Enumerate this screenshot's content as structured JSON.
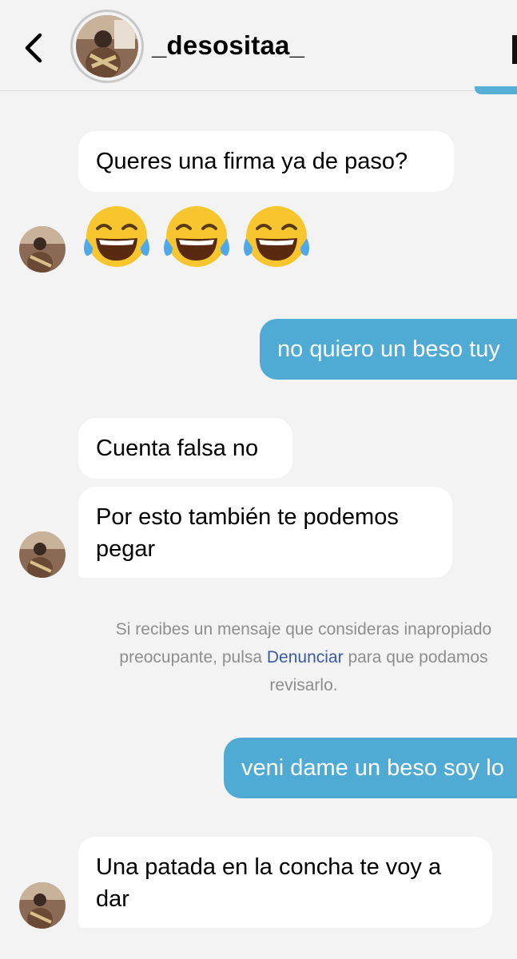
{
  "header": {
    "username": "_desositaa_",
    "back_icon": "chevron-left-icon"
  },
  "messages": [
    {
      "direction": "in",
      "text": "Queres una firma ya de paso?"
    },
    {
      "direction": "in",
      "type": "emoji",
      "emojis": [
        "face-with-tears-of-joy",
        "face-with-tears-of-joy",
        "face-with-tears-of-joy"
      ]
    },
    {
      "direction": "out",
      "text": "no quiero un beso tuy"
    },
    {
      "direction": "in",
      "text": "Cuenta falsa no"
    },
    {
      "direction": "in",
      "text_line1": "Por esto también te podemos",
      "text_line2": "pegar"
    },
    {
      "direction": "out",
      "text": "veni dame un beso soy lo"
    },
    {
      "direction": "in",
      "text_line1": "Una patada en la concha te voy a",
      "text_line2": "dar"
    }
  ],
  "notice": {
    "line1": "Si recibes un mensaje que consideras inapropiado",
    "line2_before": "preocupante, pulsa ",
    "line2_link": "Denunciar",
    "line2_after": " para que podamos",
    "line3": "revisarlo."
  },
  "colors": {
    "background": "#f3f3f3",
    "incoming_bubble": "#ffffff",
    "outgoing_bubble": "#4fabd3",
    "link": "#3a5aa8",
    "notice_text": "#8e8e8e"
  }
}
